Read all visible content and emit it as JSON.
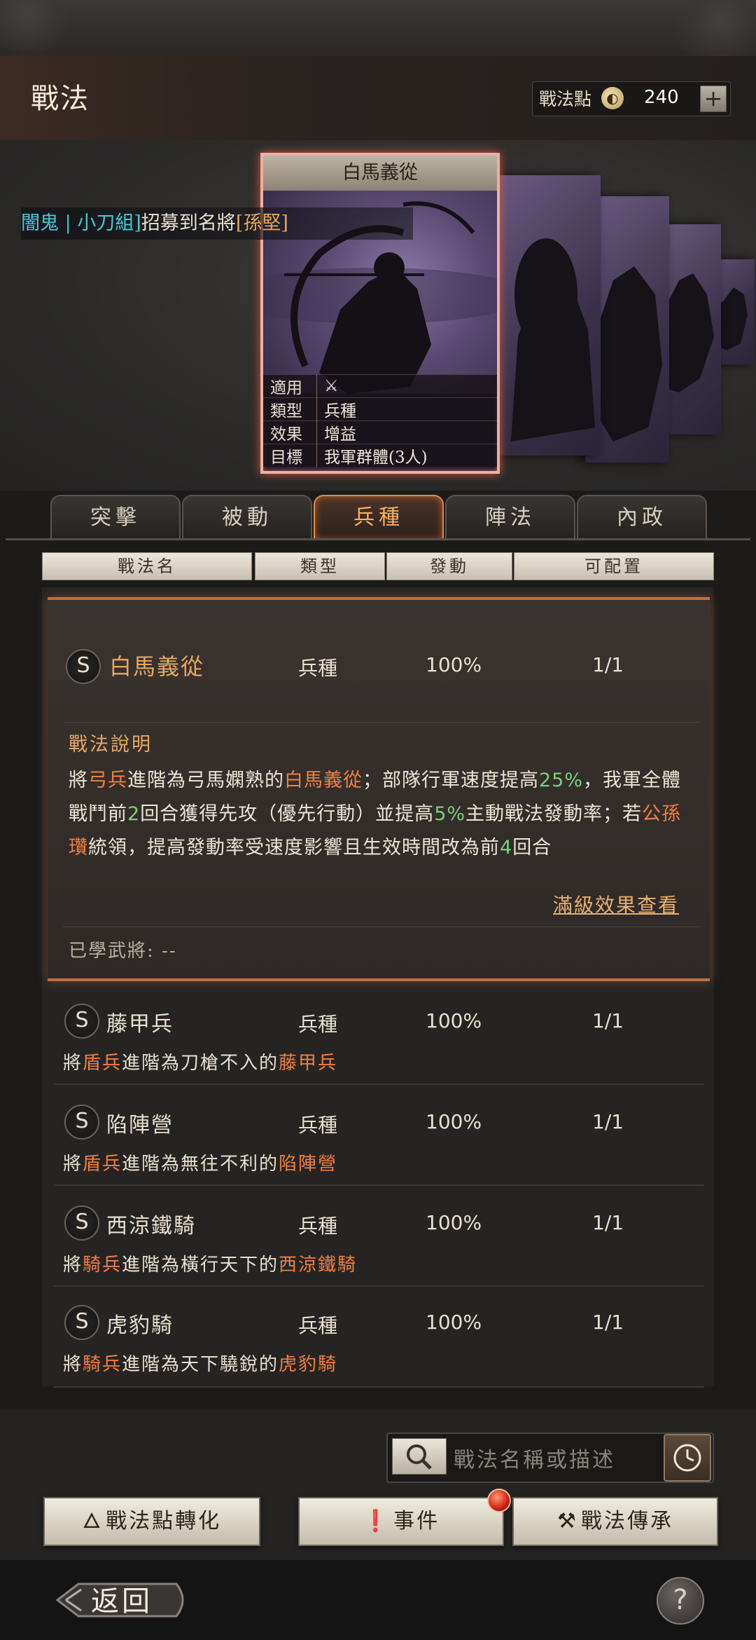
{
  "header": {
    "title": "戰法",
    "points_label": "戰法點",
    "points_icon": "coin-icon",
    "points_value": "240",
    "plus_label": "+"
  },
  "marquee": {
    "player": "闇鬼 | 小刀組",
    "text": "招募到名將",
    "general": "[孫堅]"
  },
  "card": {
    "title": "白馬義從",
    "rows": [
      {
        "k": "適用",
        "v": "⚔"
      },
      {
        "k": "類型",
        "v": "兵種"
      },
      {
        "k": "效果",
        "v": "增益"
      },
      {
        "k": "目標",
        "v": "我軍群體(3人)"
      }
    ]
  },
  "tabs": [
    "突擊",
    "被動",
    "兵種",
    "陣法",
    "內政"
  ],
  "active_tab": "兵種",
  "columns": [
    "戰法名",
    "類型",
    "發動",
    "可配置"
  ],
  "expanded": {
    "grade": "S",
    "name": "白馬義從",
    "type": "兵種",
    "rate": "100%",
    "config": "1/1",
    "desc_title": "戰法說明",
    "desc_parts": [
      "將",
      "弓兵",
      "進階為弓馬嫻熟的",
      "白馬義從",
      "；部隊行軍速度提高",
      "25%",
      "，我軍全體戰鬥前",
      "2",
      "回合獲得先攻（優先行動）並提高",
      "5%",
      "主動戰法發動率；若",
      "公孫瓚",
      "統領，提高發動率受速度影響且生效時間改為前",
      "4",
      "回合"
    ],
    "max_link": "滿級效果查看",
    "learned": "已學武將: --"
  },
  "rows": [
    {
      "grade": "S",
      "name": "藤甲兵",
      "type": "兵種",
      "rate": "100%",
      "config": "1/1",
      "d1": "將",
      "d2": "盾兵",
      "d3": "進階為刀槍不入的",
      "d4": "藤甲兵"
    },
    {
      "grade": "S",
      "name": "陷陣營",
      "type": "兵種",
      "rate": "100%",
      "config": "1/1",
      "d1": "將",
      "d2": "盾兵",
      "d3": "進階為無往不利的",
      "d4": "陷陣營"
    },
    {
      "grade": "S",
      "name": "西涼鐵騎",
      "type": "兵種",
      "rate": "100%",
      "config": "1/1",
      "d1": "將",
      "d2": "騎兵",
      "d3": "進階為橫行天下的",
      "d4": "西涼鐵騎"
    },
    {
      "grade": "S",
      "name": "虎豹騎",
      "type": "兵種",
      "rate": "100%",
      "config": "1/1",
      "d1": "將",
      "d2": "騎兵",
      "d3": "進階為天下驍銳的",
      "d4": "虎豹騎"
    }
  ],
  "search": {
    "placeholder": "戰法名稱或描述"
  },
  "buttons": {
    "convert": "戰法點轉化",
    "events": "事件",
    "inherit": "戰法傳承"
  },
  "footer": {
    "back": "返回",
    "help": "?"
  },
  "colors": {
    "accent": "#f8b060",
    "highlight": "#f08040",
    "green": "#7acf7a",
    "card_border": "#e8b0a6"
  }
}
